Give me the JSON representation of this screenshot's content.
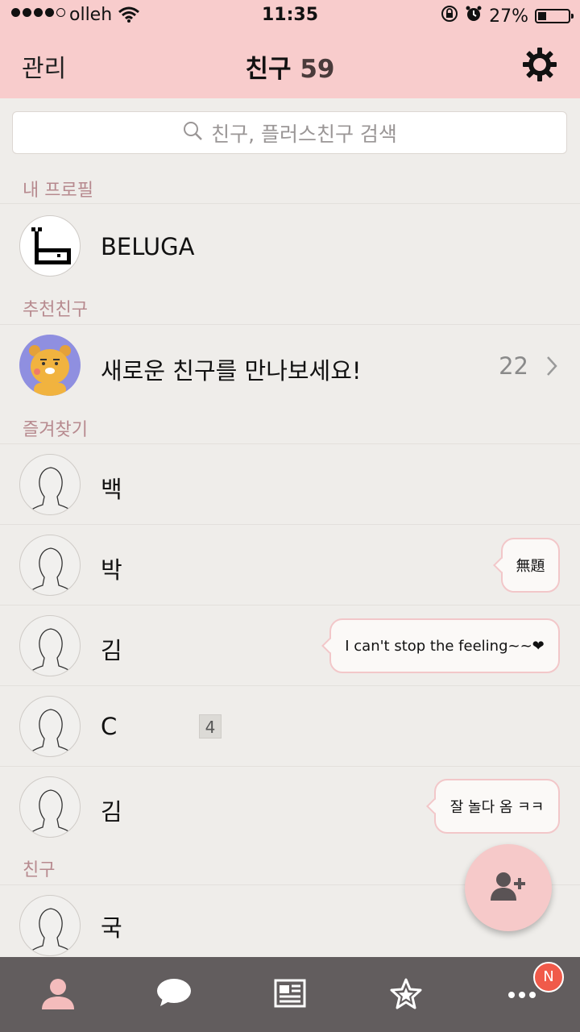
{
  "status_bar": {
    "carrier": "olleh",
    "time": "11:35",
    "battery": "27%",
    "battery_level": 0.27,
    "signal_bars": 4
  },
  "header": {
    "left_label": "관리",
    "title": "친구",
    "count": "59",
    "settings_icon": "gear-icon"
  },
  "search": {
    "placeholder": "친구, 플러스친구 검색"
  },
  "sections": {
    "my_profile": "내 프로필",
    "recommended": "추천친구",
    "favorites": "즐겨찾기",
    "friends": "친구"
  },
  "my_profile": {
    "name": "BELUGA"
  },
  "recommended": {
    "label": "새로운 친구를 만나보세요!",
    "count": "22"
  },
  "favorites": [
    {
      "name": "백",
      "status": ""
    },
    {
      "name": "박",
      "status": "無題"
    },
    {
      "name": "김",
      "status": "I can't stop the feeling~~❤"
    },
    {
      "name": "C",
      "badge": "4"
    },
    {
      "name": "김",
      "status": "잘 놀다 옴 ㅋㅋ"
    }
  ],
  "friends": [
    {
      "name": "국"
    }
  ],
  "tabbar": {
    "tabs": [
      "person-icon",
      "chat-bubble-icon",
      "news-icon",
      "star-icon",
      "more-icon"
    ],
    "notification": "N"
  },
  "colors": {
    "header_bg": "#f8cccc",
    "background": "#efedea",
    "section_header": "#b78a8f",
    "tabbar_bg": "#625d5e",
    "bubble_border": "#f2c7c9",
    "notif_badge": "#f05a4a"
  }
}
